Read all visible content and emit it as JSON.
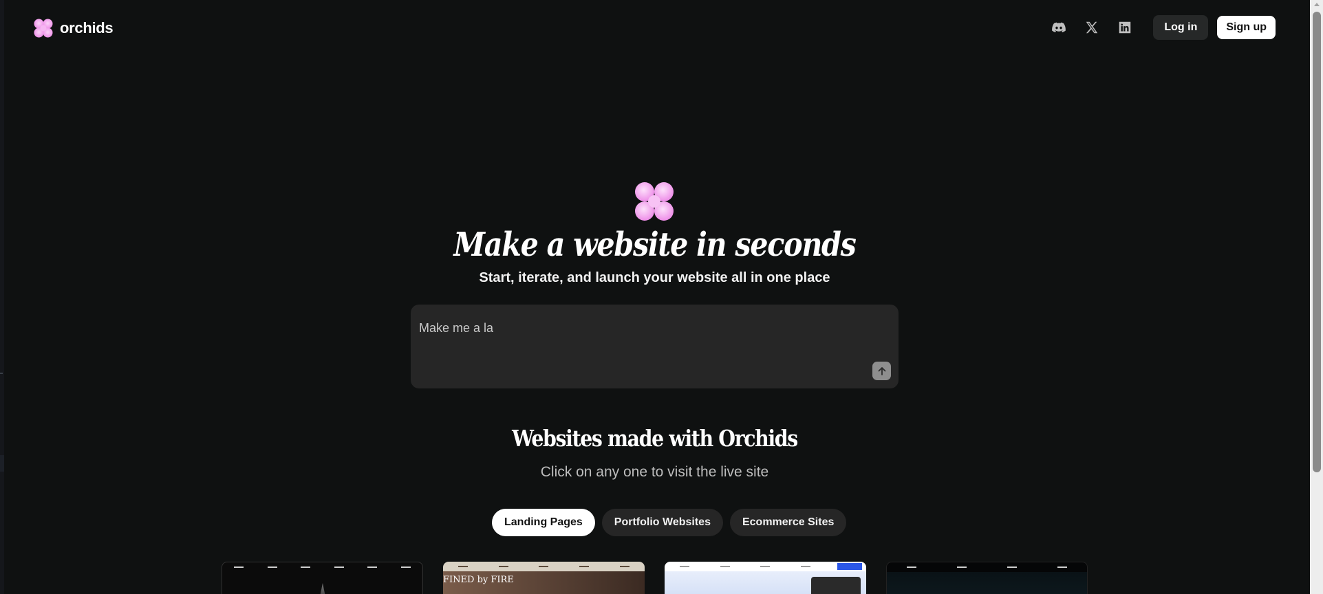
{
  "brand": {
    "name": "orchids",
    "logo_icon": "orchid-flower-icon",
    "logo_color": "#f4a2f0"
  },
  "header": {
    "social": [
      {
        "name": "discord",
        "icon": "discord-icon"
      },
      {
        "name": "x",
        "icon": "x-icon"
      },
      {
        "name": "linkedin",
        "icon": "linkedin-icon"
      }
    ],
    "login_label": "Log in",
    "signup_label": "Sign up"
  },
  "hero": {
    "title": "Make a website in seconds",
    "subtitle": "Start, iterate, and launch your website all in one place",
    "prompt_value": "Make me a la",
    "send_icon": "arrow-up-icon"
  },
  "showcase": {
    "title": "Websites made with Orchids",
    "subtitle": "Click on any one to visit the live site",
    "tabs": [
      {
        "label": "Landing Pages",
        "active": true
      },
      {
        "label": "Portfolio Websites",
        "active": false
      },
      {
        "label": "Ecommerce Sites",
        "active": false
      }
    ],
    "cards": [
      {
        "theme": "dark"
      },
      {
        "caption": "FINED by FIRE"
      },
      {
        "theme": "light"
      },
      {
        "theme": "dark"
      }
    ]
  },
  "colors": {
    "background": "#0f1111",
    "surface": "#262626",
    "accent_pink": "#f4a2f0",
    "text": "#ffffff"
  }
}
